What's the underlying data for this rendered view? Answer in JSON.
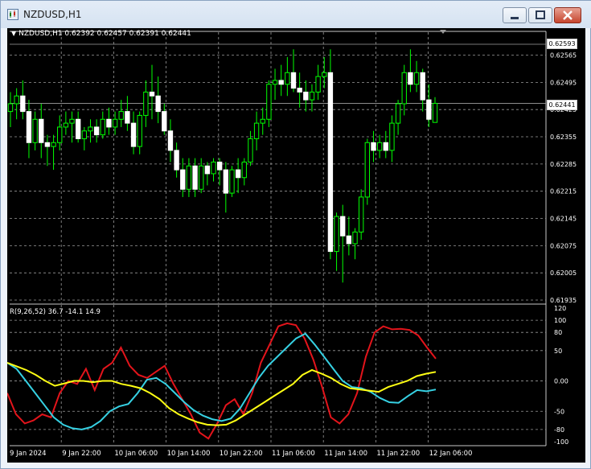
{
  "window": {
    "title": "NZDUSD,H1",
    "icon": "chart-window-icon",
    "buttons": [
      "minimize-icon",
      "maximize-icon",
      "close-icon"
    ]
  },
  "chart_header": "NZDUSD,H1  0.62392 0.62457 0.62391 0.62441",
  "price_tags": {
    "high": "0.62593",
    "current": "0.62441"
  },
  "oscillator_label": "R(9,26,52) 36.7 -14.1 14.9",
  "colors": {
    "background": "#000000",
    "grid": "#9a9a9a",
    "bull_candle": "#00ff00",
    "candle_body": "#ffffff",
    "osc_red": "#e3141b",
    "osc_cyan": "#36d1e3",
    "osc_yellow": "#ffff14",
    "text": "#ffffff"
  },
  "chart_data": [
    {
      "type": "candlestick",
      "title": "NZDUSD,H1",
      "ylim": [
        0.61935,
        0.62593
      ],
      "y_ticks": [
        "0.62565",
        "0.62495",
        "0.62425",
        "0.62355",
        "0.62285",
        "0.62215",
        "0.62145",
        "0.62075",
        "0.62005",
        "0.61935"
      ],
      "y_tick_values": [
        0.62565,
        0.62495,
        0.62425,
        0.62355,
        0.62285,
        0.62215,
        0.62145,
        0.62075,
        0.62005,
        0.61935
      ],
      "x_ticks": [
        "9 Jan 2024",
        "9 Jan 22:00",
        "10 Jan 06:00",
        "10 Jan 14:00",
        "10 Jan 22:00",
        "11 Jan 06:00",
        "11 Jan 14:00",
        "11 Jan 22:00",
        "12 Jan 06:00"
      ],
      "candles": [
        {
          "o": 0.6242,
          "h": 0.6247,
          "l": 0.6238,
          "c": 0.6244
        },
        {
          "o": 0.6244,
          "h": 0.6248,
          "l": 0.624,
          "c": 0.6246
        },
        {
          "o": 0.6246,
          "h": 0.625,
          "l": 0.624,
          "c": 0.6242
        },
        {
          "o": 0.6242,
          "h": 0.6245,
          "l": 0.623,
          "c": 0.6234
        },
        {
          "o": 0.6234,
          "h": 0.6242,
          "l": 0.6232,
          "c": 0.624
        },
        {
          "o": 0.624,
          "h": 0.6244,
          "l": 0.623,
          "c": 0.6234
        },
        {
          "o": 0.6234,
          "h": 0.6236,
          "l": 0.6228,
          "c": 0.6233
        },
        {
          "o": 0.6233,
          "h": 0.6236,
          "l": 0.6227,
          "c": 0.6234
        },
        {
          "o": 0.6234,
          "h": 0.6241,
          "l": 0.6232,
          "c": 0.6238
        },
        {
          "o": 0.6238,
          "h": 0.6242,
          "l": 0.6236,
          "c": 0.6239
        },
        {
          "o": 0.6239,
          "h": 0.6242,
          "l": 0.6234,
          "c": 0.624
        },
        {
          "o": 0.624,
          "h": 0.6242,
          "l": 0.6234,
          "c": 0.6235
        },
        {
          "o": 0.6235,
          "h": 0.6238,
          "l": 0.6232,
          "c": 0.6237
        },
        {
          "o": 0.6237,
          "h": 0.624,
          "l": 0.6234,
          "c": 0.6238
        },
        {
          "o": 0.6238,
          "h": 0.624,
          "l": 0.6234,
          "c": 0.6236
        },
        {
          "o": 0.6236,
          "h": 0.6242,
          "l": 0.6235,
          "c": 0.624
        },
        {
          "o": 0.624,
          "h": 0.6243,
          "l": 0.6236,
          "c": 0.6238
        },
        {
          "o": 0.6238,
          "h": 0.6242,
          "l": 0.6236,
          "c": 0.624
        },
        {
          "o": 0.624,
          "h": 0.6245,
          "l": 0.6238,
          "c": 0.6242
        },
        {
          "o": 0.6242,
          "h": 0.6246,
          "l": 0.6237,
          "c": 0.6239
        },
        {
          "o": 0.6239,
          "h": 0.6242,
          "l": 0.6231,
          "c": 0.6233
        },
        {
          "o": 0.6233,
          "h": 0.6242,
          "l": 0.6231,
          "c": 0.6241
        },
        {
          "o": 0.6241,
          "h": 0.625,
          "l": 0.6238,
          "c": 0.6247
        },
        {
          "o": 0.6247,
          "h": 0.6254,
          "l": 0.624,
          "c": 0.6246
        },
        {
          "o": 0.6246,
          "h": 0.6251,
          "l": 0.6239,
          "c": 0.6242
        },
        {
          "o": 0.6242,
          "h": 0.6244,
          "l": 0.6236,
          "c": 0.6237
        },
        {
          "o": 0.6237,
          "h": 0.624,
          "l": 0.6229,
          "c": 0.6232
        },
        {
          "o": 0.6232,
          "h": 0.6234,
          "l": 0.6225,
          "c": 0.6227
        },
        {
          "o": 0.6227,
          "h": 0.623,
          "l": 0.622,
          "c": 0.6222
        },
        {
          "o": 0.6222,
          "h": 0.623,
          "l": 0.622,
          "c": 0.6228
        },
        {
          "o": 0.6228,
          "h": 0.623,
          "l": 0.622,
          "c": 0.6222
        },
        {
          "o": 0.6222,
          "h": 0.623,
          "l": 0.6221,
          "c": 0.6228
        },
        {
          "o": 0.6228,
          "h": 0.6229,
          "l": 0.6223,
          "c": 0.6226
        },
        {
          "o": 0.6226,
          "h": 0.623,
          "l": 0.6224,
          "c": 0.6229
        },
        {
          "o": 0.6229,
          "h": 0.623,
          "l": 0.6223,
          "c": 0.6227
        },
        {
          "o": 0.6227,
          "h": 0.6229,
          "l": 0.6216,
          "c": 0.6221
        },
        {
          "o": 0.6221,
          "h": 0.6228,
          "l": 0.622,
          "c": 0.6227
        },
        {
          "o": 0.6227,
          "h": 0.623,
          "l": 0.6221,
          "c": 0.6225
        },
        {
          "o": 0.6225,
          "h": 0.623,
          "l": 0.6223,
          "c": 0.6229
        },
        {
          "o": 0.6229,
          "h": 0.6237,
          "l": 0.6228,
          "c": 0.6235
        },
        {
          "o": 0.6235,
          "h": 0.6242,
          "l": 0.6232,
          "c": 0.6239
        },
        {
          "o": 0.6239,
          "h": 0.6243,
          "l": 0.6236,
          "c": 0.624
        },
        {
          "o": 0.624,
          "h": 0.625,
          "l": 0.6238,
          "c": 0.6249
        },
        {
          "o": 0.6249,
          "h": 0.6253,
          "l": 0.6245,
          "c": 0.625
        },
        {
          "o": 0.625,
          "h": 0.6254,
          "l": 0.6246,
          "c": 0.6249
        },
        {
          "o": 0.6249,
          "h": 0.6256,
          "l": 0.6246,
          "c": 0.6252
        },
        {
          "o": 0.6252,
          "h": 0.6258,
          "l": 0.6247,
          "c": 0.6248
        },
        {
          "o": 0.6248,
          "h": 0.6252,
          "l": 0.6243,
          "c": 0.6247
        },
        {
          "o": 0.6247,
          "h": 0.625,
          "l": 0.6242,
          "c": 0.6245
        },
        {
          "o": 0.6245,
          "h": 0.6249,
          "l": 0.6242,
          "c": 0.6247
        },
        {
          "o": 0.6247,
          "h": 0.6254,
          "l": 0.6245,
          "c": 0.6251
        },
        {
          "o": 0.6251,
          "h": 0.6256,
          "l": 0.6248,
          "c": 0.6252
        },
        {
          "o": 0.6252,
          "h": 0.6258,
          "l": 0.6204,
          "c": 0.6206
        },
        {
          "o": 0.6206,
          "h": 0.6216,
          "l": 0.6201,
          "c": 0.6215
        },
        {
          "o": 0.6215,
          "h": 0.6218,
          "l": 0.6198,
          "c": 0.621
        },
        {
          "o": 0.621,
          "h": 0.6215,
          "l": 0.6205,
          "c": 0.6208
        },
        {
          "o": 0.6208,
          "h": 0.6212,
          "l": 0.6204,
          "c": 0.6211
        },
        {
          "o": 0.6211,
          "h": 0.6222,
          "l": 0.6209,
          "c": 0.622
        },
        {
          "o": 0.622,
          "h": 0.6235,
          "l": 0.6218,
          "c": 0.6234
        },
        {
          "o": 0.6234,
          "h": 0.6237,
          "l": 0.6229,
          "c": 0.6232
        },
        {
          "o": 0.6232,
          "h": 0.6236,
          "l": 0.623,
          "c": 0.6234
        },
        {
          "o": 0.6234,
          "h": 0.6237,
          "l": 0.623,
          "c": 0.6232
        },
        {
          "o": 0.6232,
          "h": 0.6241,
          "l": 0.6229,
          "c": 0.6239
        },
        {
          "o": 0.6239,
          "h": 0.6245,
          "l": 0.6236,
          "c": 0.6244
        },
        {
          "o": 0.6244,
          "h": 0.6254,
          "l": 0.6241,
          "c": 0.6252
        },
        {
          "o": 0.6252,
          "h": 0.6258,
          "l": 0.6247,
          "c": 0.6249
        },
        {
          "o": 0.6249,
          "h": 0.6255,
          "l": 0.6247,
          "c": 0.6252
        },
        {
          "o": 0.6252,
          "h": 0.6253,
          "l": 0.6242,
          "c": 0.6245
        },
        {
          "o": 0.6245,
          "h": 0.6249,
          "l": 0.6238,
          "c": 0.624
        },
        {
          "o": 0.62392,
          "h": 0.62457,
          "l": 0.62391,
          "c": 0.62441
        }
      ]
    },
    {
      "type": "line",
      "title": "R(9,26,52) 36.7 -14.1 14.9",
      "ylim": [
        -100,
        120
      ],
      "y_ticks": [
        "120",
        "100",
        "80",
        "50",
        "0.00",
        "-50",
        "-80",
        "-100"
      ],
      "y_tick_values": [
        120,
        100,
        80,
        50,
        0,
        -50,
        -80,
        -100
      ],
      "series": [
        {
          "name": "R(9)",
          "color": "red",
          "values": [
            -20,
            -55,
            -70,
            -65,
            -55,
            -60,
            -20,
            0,
            -5,
            20,
            -15,
            20,
            30,
            55,
            25,
            10,
            5,
            15,
            25,
            -5,
            -30,
            -55,
            -85,
            -95,
            -70,
            -40,
            -30,
            -55,
            -20,
            30,
            60,
            90,
            95,
            92,
            70,
            35,
            -10,
            -60,
            -70,
            -55,
            -20,
            40,
            80,
            90,
            85,
            86,
            84,
            75,
            55,
            36.7
          ]
        },
        {
          "name": "R(26)",
          "color": "cyan",
          "values": [
            30,
            20,
            0,
            -20,
            -40,
            -60,
            -72,
            -78,
            -80,
            -76,
            -66,
            -50,
            -42,
            -38,
            -20,
            2,
            5,
            -5,
            -20,
            -35,
            -48,
            -57,
            -63,
            -66,
            -62,
            -45,
            -20,
            5,
            25,
            40,
            55,
            70,
            78,
            60,
            40,
            20,
            0,
            -10,
            -12,
            -18,
            -28,
            -35,
            -36,
            -25,
            -15,
            -17,
            -14.1
          ]
        },
        {
          "name": "R(52)",
          "color": "yellow",
          "values": [
            30,
            24,
            18,
            10,
            0,
            -8,
            -4,
            0,
            0,
            -2,
            0,
            0,
            -5,
            -8,
            -12,
            -20,
            -30,
            -45,
            -55,
            -62,
            -68,
            -72,
            -73,
            -72,
            -65,
            -55,
            -45,
            -35,
            -25,
            -15,
            -5,
            10,
            18,
            12,
            5,
            -5,
            -12,
            -14,
            -16,
            -18,
            -10,
            -5,
            0,
            8,
            12,
            14.9
          ]
        }
      ],
      "horizontal_lines": [
        100,
        80,
        50,
        0,
        -50,
        -80
      ]
    }
  ]
}
